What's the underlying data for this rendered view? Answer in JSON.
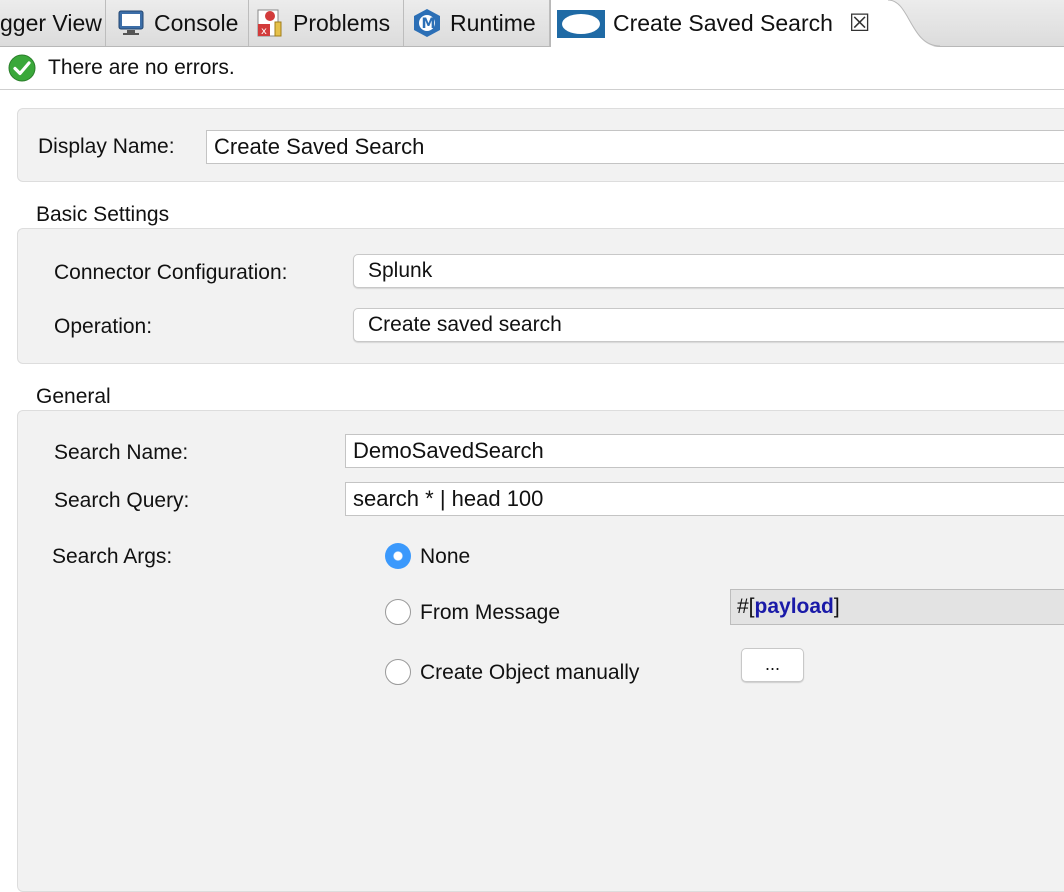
{
  "tabs": [
    {
      "label": "gger View",
      "icon": "debugger-icon"
    },
    {
      "label": "Console",
      "icon": "console-icon"
    },
    {
      "label": "Problems",
      "icon": "problems-icon"
    },
    {
      "label": "Runtime",
      "icon": "mule-runtime-icon"
    },
    {
      "label": "Create Saved Search",
      "icon": "cloud-icon",
      "active": true,
      "close_icon": "close-icon"
    }
  ],
  "status": {
    "icon": "checkmark-icon",
    "message": "There are no errors."
  },
  "display": {
    "label": "Display Name:",
    "value": "Create Saved Search"
  },
  "basic": {
    "title": "Basic Settings",
    "connector_label": "Connector Configuration:",
    "connector_value": "Splunk",
    "operation_label": "Operation:",
    "operation_value": "Create saved search"
  },
  "general": {
    "title": "General",
    "search_name_label": "Search Name:",
    "search_name_value": "DemoSavedSearch",
    "search_query_label": "Search Query:",
    "search_query_value": "search * | head 100",
    "search_args_label": "Search Args:",
    "options": [
      "None",
      "From Message",
      "Create Object manually"
    ],
    "selected_option": "None",
    "expr_prefix": "#[",
    "expr_keyword": "payload",
    "expr_suffix": "]",
    "ellipsis_label": "..."
  },
  "colors": {
    "accent": "#3b99fc",
    "ok": "#3aa83a",
    "expression_keyword": "#1a1aa8"
  }
}
